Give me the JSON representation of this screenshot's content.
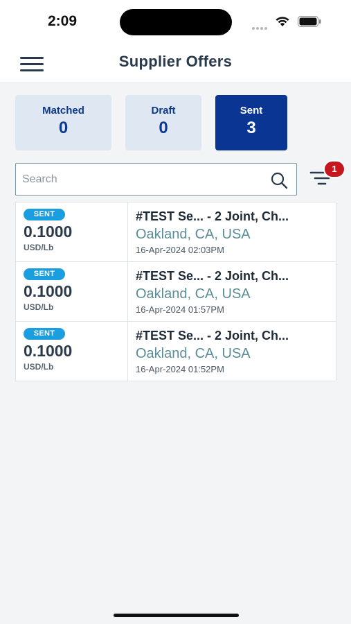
{
  "status_bar": {
    "time": "2:09"
  },
  "header": {
    "title": "Supplier Offers",
    "menu_icon": "hamburger-menu-icon"
  },
  "summary": [
    {
      "label": "Matched",
      "count": "0",
      "active": false
    },
    {
      "label": "Draft",
      "count": "0",
      "active": false
    },
    {
      "label": "Sent",
      "count": "3",
      "active": true
    }
  ],
  "search": {
    "placeholder": "Search",
    "value": ""
  },
  "filter": {
    "badge_count": "1"
  },
  "offers": [
    {
      "status": "SENT",
      "price": "0.1000",
      "unit": "USD/Lb",
      "title": "#TEST Se...  - 2 Joint, Ch...",
      "location": "Oakland, CA, USA",
      "date": "16-Apr-2024 02:03PM"
    },
    {
      "status": "SENT",
      "price": "0.1000",
      "unit": "USD/Lb",
      "title": "#TEST Se...  - 2 Joint, Ch...",
      "location": "Oakland, CA, USA",
      "date": "16-Apr-2024 01:57PM"
    },
    {
      "status": "SENT",
      "price": "0.1000",
      "unit": "USD/Lb",
      "title": "#TEST Se...  - 2 Joint, Ch...",
      "location": "Oakland, CA, USA",
      "date": "16-Apr-2024 01:52PM"
    }
  ],
  "colors": {
    "primary": "#0a3592",
    "card_inactive": "#dfe7f3",
    "sent_pill": "#1b9ee0",
    "location_text": "#5b8d96",
    "badge": "#c8161d"
  }
}
